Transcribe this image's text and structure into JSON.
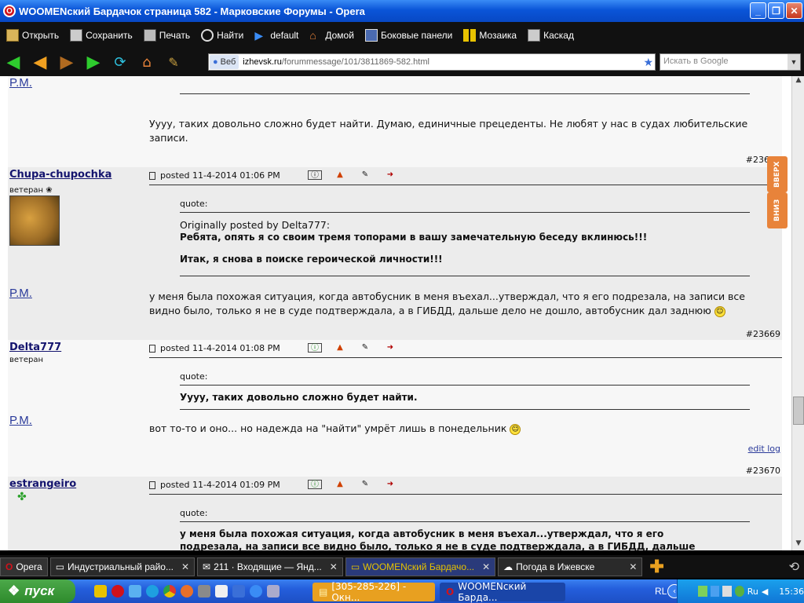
{
  "window": {
    "title": "WOOMENский Бардачок страница 582 - Марковские Форумы - Opera",
    "buttons": [
      "_",
      "❐",
      "✕"
    ]
  },
  "menubar": {
    "items": [
      {
        "label": "Открыть",
        "icon": "folder-icon"
      },
      {
        "label": "Сохранить",
        "icon": "disk-icon"
      },
      {
        "label": "Печать",
        "icon": "printer-icon"
      },
      {
        "label": "Найти",
        "icon": "magnifier-icon"
      },
      {
        "label": "default",
        "icon": "play-icon"
      },
      {
        "label": "Домой",
        "icon": "house-icon"
      },
      {
        "label": "Боковые панели",
        "icon": "panels-icon"
      },
      {
        "label": "Мозаика",
        "icon": "tile-icon"
      },
      {
        "label": "Каскад",
        "icon": "cascade-icon"
      }
    ]
  },
  "address": {
    "badge": "Веб",
    "host": "izhevsk.ru",
    "path": "/forummessage/101/3811869-582.html"
  },
  "search": {
    "placeholder": "Искать в Google"
  },
  "posts": {
    "p0": {
      "sig": "P.M.",
      "text": "Уууу, таких довольно сложно будет найти. Думаю, единичные прецеденты. Не любят у нас в судах любительские записи.",
      "num": "#23666"
    },
    "p1": {
      "user": "Chupa-chupochka",
      "rank": "ветеран",
      "posted": "posted 11-4-2014 01:06 PM",
      "quote_label": "quote:",
      "quote_author": "Originally posted by Delta777:",
      "quote_line1": "Ребята, опять я со своим тремя топорами в вашу замечательную беседу вклинюсь!!!",
      "quote_line2": "Итак, я снова в поиске героической личности!!!",
      "sig": "P.M.",
      "text": "у меня была похожая ситуация, когда автобусник в меня въехал...утверждал, что я его подрезала, на записи все видно было, только я не в суде подтверждала, а в ГИБДД, дальше дело не дошло, автобусник дал заднюю",
      "num": "#23669"
    },
    "p2": {
      "user": "Delta777",
      "rank": "ветеран",
      "posted": "posted 11-4-2014 01:08 PM",
      "quote_label": "quote:",
      "quote_line1": "Уууу, таких довольно сложно будет найти.",
      "sig": "P.M.",
      "text": "вот то-то и оно... но надежда на \"найти\" умрёт лишь в понедельник",
      "editlog": "edit log",
      "num": "#23670"
    },
    "p3": {
      "user": "estrangeiro",
      "posted": "posted 11-4-2014 01:09 PM",
      "quote_label": "quote:",
      "quote_line1": "у меня была похожая ситуация, когда автобусник в меня въехал...утверждал, что я его",
      "quote_line2": "подрезала, на записи все видно было, только я не в суде подтверждала, а в ГИБДД, дальше"
    }
  },
  "side": {
    "up": "ВВЕРХ",
    "down": "ВНИЗ"
  },
  "tabs": [
    {
      "label": "Opera",
      "kind": "menu"
    },
    {
      "label": "Индустриальный райо...",
      "kind": "tab"
    },
    {
      "label": "211 · Входящие — Янд...",
      "kind": "tab"
    },
    {
      "label": "WOOMENский Бардачо...",
      "kind": "active"
    },
    {
      "label": "Погода в Ижевске",
      "kind": "tab"
    }
  ],
  "taskbar": {
    "start": "пуск",
    "tasks": [
      "[305-285-226] - Окн...",
      "WOOMENский Бардa..."
    ],
    "lang": "RL",
    "tray_lang": "Ru",
    "clock": "15:36"
  }
}
